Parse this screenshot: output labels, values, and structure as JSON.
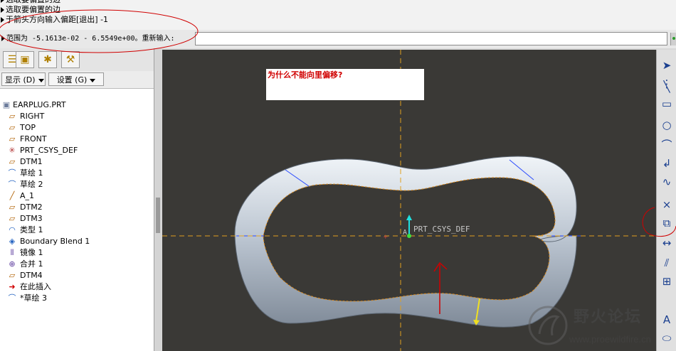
{
  "message_area": {
    "lines": [
      "选取要偏置的边",
      "于箭头方向输入偏距[退出]  -1",
      "范围为 -5.1613e-02 - 6.5549e+00。重新输入:"
    ],
    "input_value": ""
  },
  "model_tree": {
    "menu_display": "显示 (D)",
    "menu_settings": "设置 (G)",
    "items": [
      {
        "label": "EARPLUG.PRT",
        "icon": "part-icon"
      },
      {
        "label": "RIGHT",
        "icon": "datum-plane-icon"
      },
      {
        "label": "TOP",
        "icon": "datum-plane-icon"
      },
      {
        "label": "FRONT",
        "icon": "datum-plane-icon"
      },
      {
        "label": "PRT_CSYS_DEF",
        "icon": "csys-icon"
      },
      {
        "label": "DTM1",
        "icon": "datum-plane-icon"
      },
      {
        "label": "草绘 1",
        "icon": "sketch-icon"
      },
      {
        "label": "草绘 2",
        "icon": "sketch-icon"
      },
      {
        "label": "A_1",
        "icon": "datum-axis-icon"
      },
      {
        "label": "DTM2",
        "icon": "datum-plane-icon"
      },
      {
        "label": "DTM3",
        "icon": "datum-plane-icon"
      },
      {
        "label": "类型 1",
        "icon": "style-icon"
      },
      {
        "label": "Boundary Blend 1",
        "icon": "boundary-blend-icon"
      },
      {
        "label": "镜像 1",
        "icon": "mirror-icon"
      },
      {
        "label": "合并 1",
        "icon": "merge-icon"
      },
      {
        "label": "DTM4",
        "icon": "datum-plane-icon"
      },
      {
        "label": "在此插入",
        "icon": "insert-here-icon"
      },
      {
        "label": "*草绘 3",
        "icon": "sketch-icon"
      }
    ]
  },
  "graphics": {
    "note": "为什么不能向里偏移?",
    "csys_label": "PRT_CSYS_DEF",
    "axis_label": "A"
  },
  "watermark": {
    "title": "野火论坛",
    "url": "www.proewildfire.cn"
  },
  "colors": {
    "viewport_bg": "#3a3936",
    "annotation_red": "#d00000",
    "centerline": "#e0a020"
  }
}
